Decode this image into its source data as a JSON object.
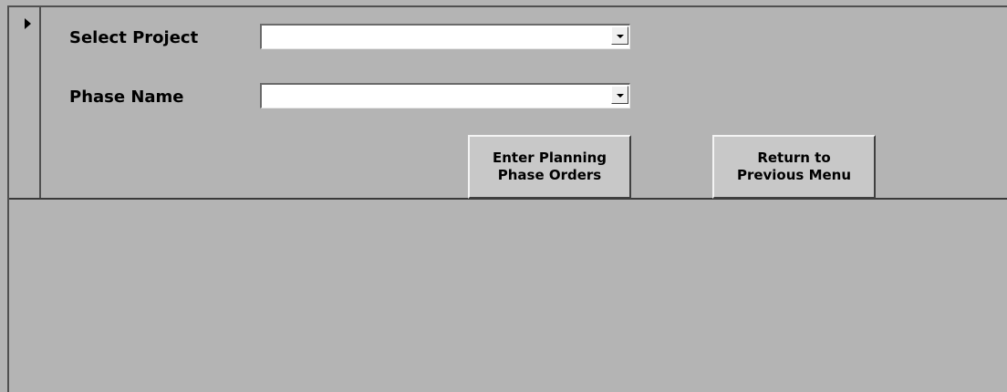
{
  "form": {
    "select_project": {
      "label": "Select Project",
      "value": ""
    },
    "phase_name": {
      "label": "Phase Name",
      "value": ""
    },
    "buttons": {
      "enter_planning": {
        "line1": "Enter Planning",
        "line2": "Phase Orders"
      },
      "return_previous": {
        "line1": "Return to",
        "line2": "Previous Menu"
      }
    }
  },
  "icons": {
    "record_selector": "current-record-arrow-icon",
    "dropdown": "chevron-down-icon"
  },
  "colors": {
    "form_background": "#b4b4b4",
    "input_background": "#ffffff",
    "button_face": "#c8c8c8"
  }
}
